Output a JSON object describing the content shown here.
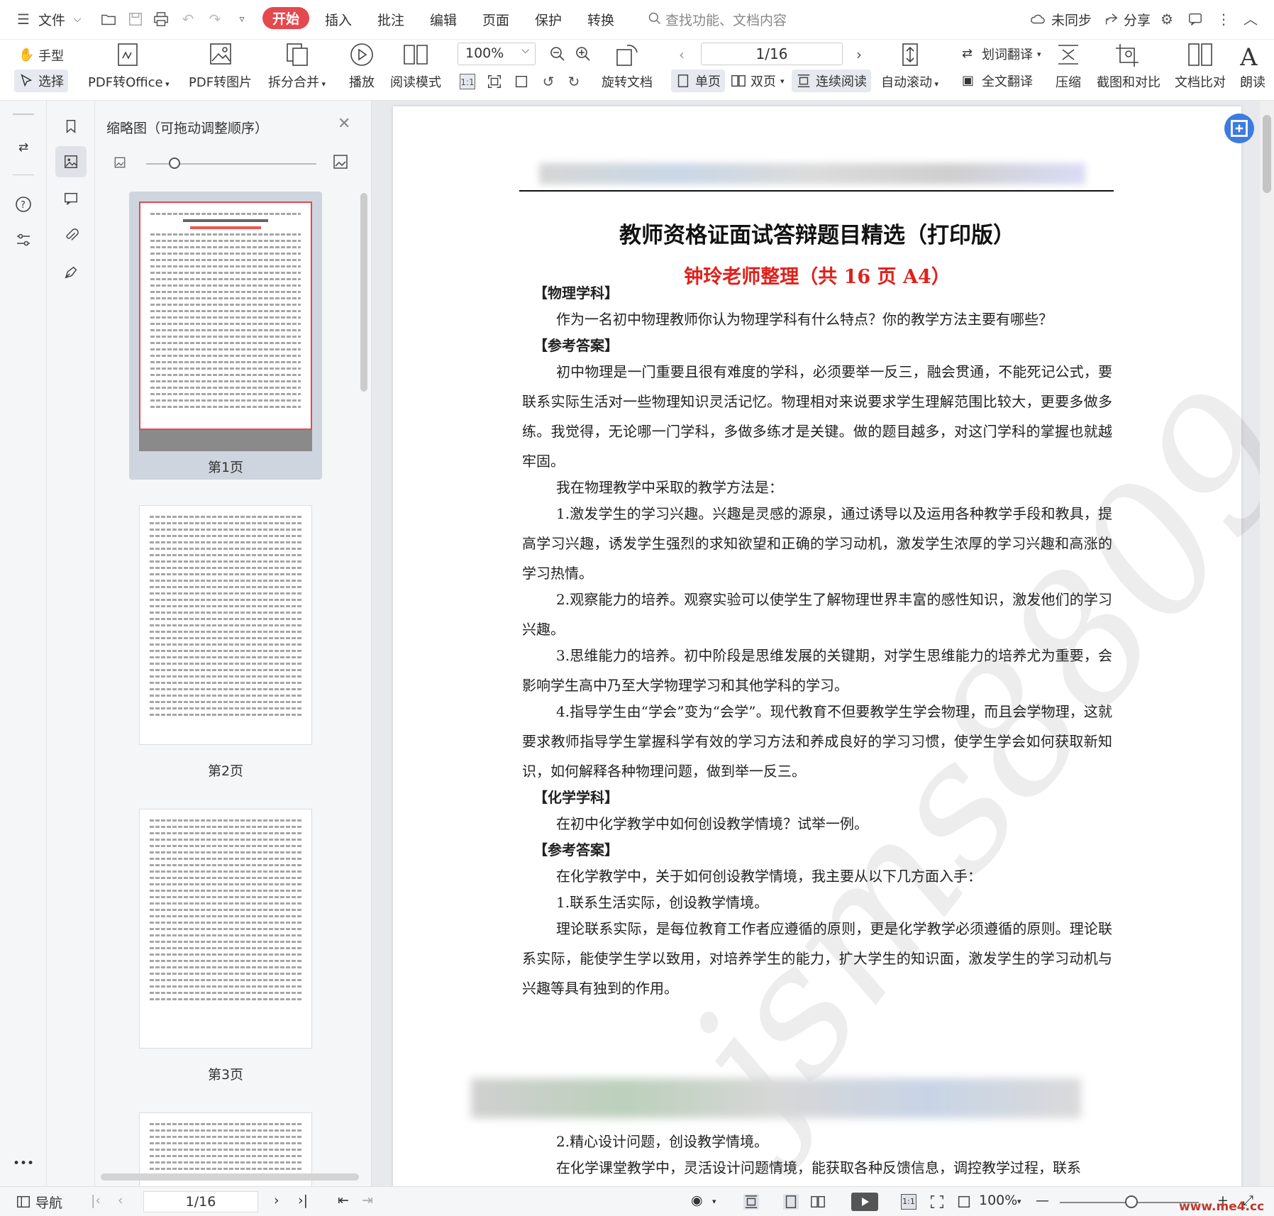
{
  "menubar": {
    "file": "文件",
    "tabs": [
      {
        "label": "开始",
        "active": true
      },
      {
        "label": "插入",
        "active": false
      },
      {
        "label": "批注",
        "active": false
      },
      {
        "label": "编辑",
        "active": false
      },
      {
        "label": "页面",
        "active": false
      },
      {
        "label": "保护",
        "active": false
      },
      {
        "label": "转换",
        "active": false
      }
    ],
    "search_placeholder": "查找功能、文档内容",
    "sync": "未同步",
    "share": "分享"
  },
  "toolbar": {
    "hand": "手型",
    "select": "选择",
    "pdf_to_office": "PDF转Office",
    "pdf_to_image": "PDF转图片",
    "split_merge": "拆分合并",
    "play": "播放",
    "reading_mode": "阅读模式",
    "zoom": "100%",
    "rotate": "旋转文档",
    "page_indicator": "1/16",
    "single_page": "单页",
    "double_page": "双页",
    "continuous": "连续阅读",
    "auto_scroll": "自动滚动",
    "word_translate": "划词翻译",
    "full_translate": "全文翻译",
    "compress": "压缩",
    "screenshot_compare": "截图和对比",
    "doc_compare": "文档比对",
    "read_aloud": "朗读"
  },
  "thumbnails": {
    "title": "缩略图（可拖动调整顺序）",
    "pages": [
      {
        "label": "第1页",
        "selected": true
      },
      {
        "label": "第2页",
        "selected": false
      },
      {
        "label": "第3页",
        "selected": false
      }
    ]
  },
  "document": {
    "title": "教师资格证面试答辩题目精选（打印版）",
    "subtitle": "钟玲老师整理（共 16 页 A4）",
    "watermark": "jsms8809",
    "paragraphs": [
      {
        "text": "【物理学科】",
        "style": "heading"
      },
      {
        "text": "作为一名初中物理教师你认为物理学科有什么特点？你的教学方法主要有哪些？",
        "style": "indent"
      },
      {
        "text": "【参考答案】",
        "style": "heading"
      },
      {
        "text": "初中物理是一门重要且很有难度的学科，必须要举一反三，融会贯通，不能死记公式，要联系实际生活对一些物理知识灵活记忆。物理相对来说要求学生理解范围比较大，更要多做多练。我觉得，无论哪一门学科，多做多练才是关键。做的题目越多，对这门学科的掌握也就越牢固。",
        "style": "indent"
      },
      {
        "text": "我在物理教学中采取的教学方法是：",
        "style": "indent"
      },
      {
        "text": "1.激发学生的学习兴趣。兴趣是灵感的源泉，通过诱导以及运用各种教学手段和教具，提高学习兴趣，诱发学生强烈的求知欲望和正确的学习动机，激发学生浓厚的学习兴趣和高涨的学习热情。",
        "style": "indent"
      },
      {
        "text": "2.观察能力的培养。观察实验可以使学生了解物理世界丰富的感性知识，激发他们的学习兴趣。",
        "style": "indent"
      },
      {
        "text": "3.思维能力的培养。初中阶段是思维发展的关键期，对学生思维能力的培养尤为重要，会影响学生高中乃至大学物理学习和其他学科的学习。",
        "style": "indent"
      },
      {
        "text": "4.指导学生由“学会”变为“会学”。现代教育不但要教学生学会物理，而且会学物理，这就要求教师指导学生掌握科学有效的学习方法和养成良好的学习习惯，使学生学会如何获取新知识，如何解释各种物理问题，做到举一反三。",
        "style": "indent"
      },
      {
        "text": "【化学学科】",
        "style": "heading"
      },
      {
        "text": "在初中化学教学中如何创设教学情境？试举一例。",
        "style": "indent"
      },
      {
        "text": "【参考答案】",
        "style": "heading"
      },
      {
        "text": "在化学教学中，关于如何创设教学情境，我主要从以下几方面入手：",
        "style": "indent"
      },
      {
        "text": "1.联系生活实际，创设教学情境。",
        "style": "indent"
      },
      {
        "text": "理论联系实际，是每位教育工作者应遵循的原则，更是化学教学必须遵循的原则。理论联系实际，能使学生学以致用，对培养学生的能力，扩大学生的知识面，激发学生的学习动机与兴趣等具有独到的作用。",
        "style": "indent"
      }
    ],
    "paragraphs_after": [
      {
        "text": "2.精心设计问题，创设教学情境。",
        "style": "indent"
      },
      {
        "text": "在化学课堂教学中，灵活设计问题情境，能获取各种反馈信息，调控教学过程，联系",
        "style": "indent"
      }
    ]
  },
  "statusbar": {
    "nav": "导航",
    "page": "1/16",
    "zoom": "100%",
    "site": "www.me4.cc"
  },
  "colors": {
    "accent_red": "#e5484d",
    "subtitle_red": "#e0201a",
    "float_button_blue": "#3d7be0"
  }
}
